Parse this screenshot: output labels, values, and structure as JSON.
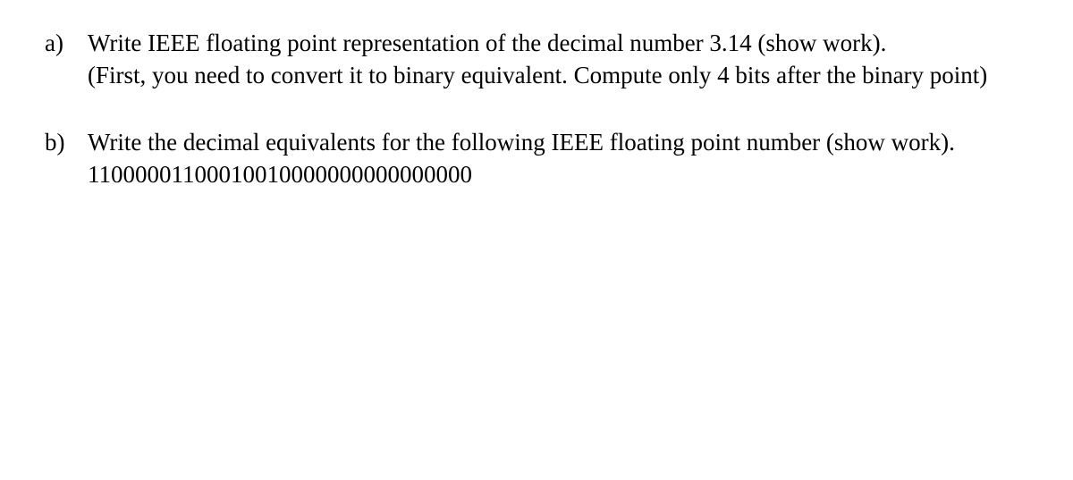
{
  "questions": {
    "a": {
      "marker": "a)",
      "line1": "Write IEEE floating point representation of the decimal number 3.14 (show work).",
      "line2": "(First, you need to convert it to binary equivalent. Compute only 4 bits after the binary point)"
    },
    "b": {
      "marker": "b)",
      "line1": "Write the decimal equivalents for the following IEEE floating point number (show work).",
      "binary": "11000001100010010000000000000000"
    }
  }
}
